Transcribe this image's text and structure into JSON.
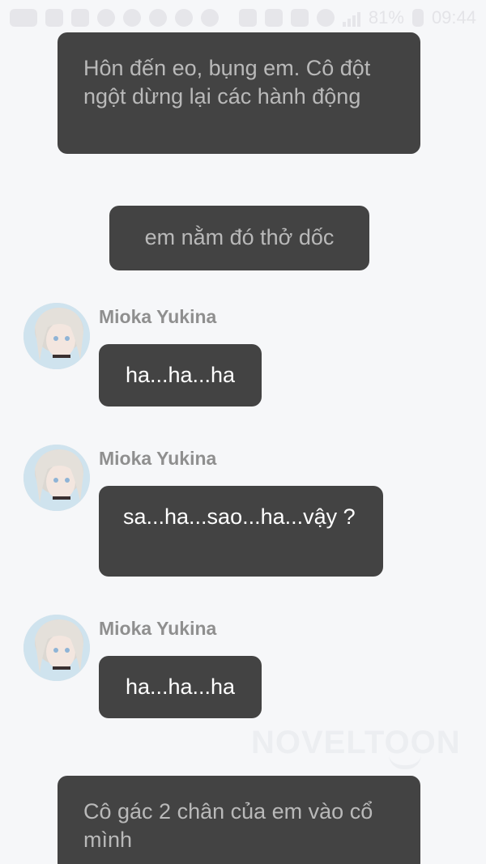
{
  "status_bar": {
    "battery": "81%",
    "time": "09:44"
  },
  "messages": [
    {
      "type": "narration",
      "text": "Hôn đến eo, bụng em. Cô đột ngột dừng lại các hành động"
    },
    {
      "type": "narration",
      "text": "em nằm đó thở dốc"
    },
    {
      "type": "character",
      "name": "Mioka Yukina",
      "text": "ha...ha...ha"
    },
    {
      "type": "character",
      "name": "Mioka Yukina",
      "text": "sa...ha...sao...ha...vậy ?"
    },
    {
      "type": "character",
      "name": "Mioka Yukina",
      "text": "ha...ha...ha"
    },
    {
      "type": "narration",
      "text": "Cô gác 2 chân của em vào cổ mình"
    }
  ],
  "watermark": "NOVELTOON"
}
